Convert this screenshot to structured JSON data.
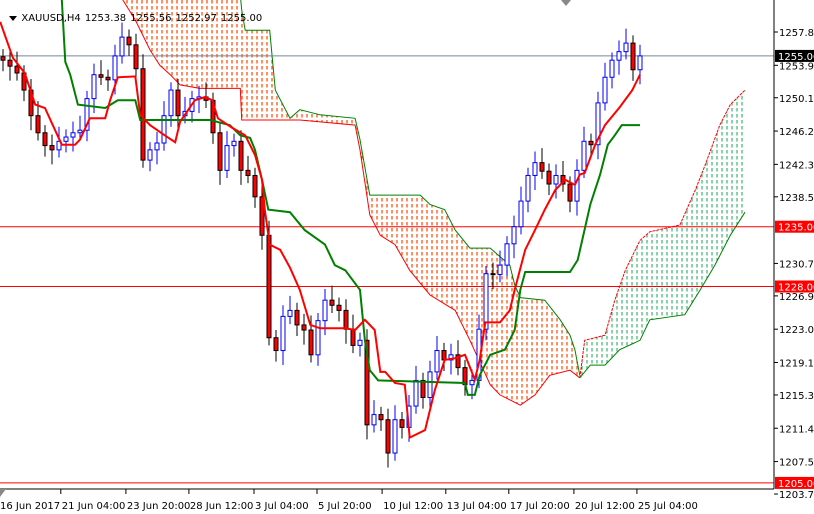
{
  "header": {
    "symbol": "XAUUSD,H4",
    "open": "1253.38",
    "high": "1255.56",
    "low": "1252.97",
    "close": "1255.00"
  },
  "colors": {
    "bull": "#0000ff",
    "bear": "#ff0000",
    "tenkan": "#ff0000",
    "kijun": "#008000",
    "cloud_bear": "#ff4500",
    "cloud_bull": "#3cb371",
    "level": "#ff0000",
    "price_line": "#778899"
  },
  "chart_data": {
    "type": "candlestick",
    "title": "XAUUSD,H4",
    "ylim": [
      1203.7,
      1257.8
    ],
    "y_ticks": [
      "1257.80",
      "1253.90",
      "1250.10",
      "1246.20",
      "1242.30",
      "1238.50",
      "1230.70",
      "1226.90",
      "1223.00",
      "1219.10",
      "1215.30",
      "1211.40",
      "1207.50",
      "1203.70"
    ],
    "x_ticks": [
      {
        "bar": 0,
        "label": "16 Jun 2017"
      },
      {
        "bar": 8.4,
        "label": "21 Jun 04:00"
      },
      {
        "bar": 17.7,
        "label": "23 Jun 20:00"
      },
      {
        "bar": 26.7,
        "label": "28 Jun 12:00"
      },
      {
        "bar": 36,
        "label": "3 Jul 04:00"
      },
      {
        "bar": 45,
        "label": "5 Jul 20:00"
      },
      {
        "bar": 54.3,
        "label": "10 Jul 12:00"
      },
      {
        "bar": 63.4,
        "label": "13 Jul 04:00"
      },
      {
        "bar": 72.4,
        "label": "17 Jul 20:00"
      },
      {
        "bar": 81.7,
        "label": "20 Jul 12:00"
      },
      {
        "bar": 90.7,
        "label": "25 Jul 04:00"
      }
    ],
    "closes": [
      1254.5,
      1253.8,
      1253,
      1251,
      1248,
      1246,
      1244.5,
      1244,
      1245,
      1245.5,
      1246,
      1246.3,
      1250,
      1252.8,
      1252.5,
      1252.2,
      1255,
      1257.2,
      1256.3,
      1253.5,
      1242.8,
      1244,
      1244.8,
      1248,
      1251,
      1248,
      1248.5,
      1250,
      1250.2,
      1249.8,
      1246,
      1241.6,
      1244.5,
      1245,
      1241.6,
      1241,
      1238.5,
      1234,
      1222,
      1220.5,
      1224.5,
      1225.2,
      1223.5,
      1222.9,
      1220,
      1224,
      1226.4,
      1225.8,
      1225.2,
      1223,
      1221.1,
      1221.7,
      1211.8,
      1213,
      1212.4,
      1208.5,
      1212.4,
      1211.5,
      1214,
      1217,
      1215,
      1218,
      1220.5,
      1219.4,
      1220,
      1218.5,
      1216.5,
      1217,
      1223,
      1229.5,
      1229.4,
      1230.5,
      1233,
      1235,
      1238,
      1241,
      1242.5,
      1241.5,
      1240,
      1241,
      1240,
      1238,
      1241.6,
      1245,
      1244.6,
      1249.5,
      1252.5,
      1254.5,
      1255.5,
      1256.5,
      1253.38,
      1255.0
    ],
    "tenkan": [
      [
        -0.4,
        1259
      ],
      [
        1.4,
        1254.8
      ],
      [
        3.1,
        1253
      ],
      [
        4.6,
        1249.3
      ],
      [
        6,
        1248.9
      ],
      [
        7,
        1247.1
      ],
      [
        8.4,
        1244.6
      ],
      [
        10.3,
        1244.6
      ],
      [
        11,
        1245.2
      ],
      [
        12.4,
        1247.7
      ],
      [
        14.6,
        1247.7
      ],
      [
        15.3,
        1249.8
      ],
      [
        16.4,
        1252.5
      ],
      [
        18.9,
        1252.6
      ],
      [
        19.6,
        1248.1
      ],
      [
        21,
        1246.9
      ],
      [
        23.1,
        1245.7
      ],
      [
        24.6,
        1244.9
      ],
      [
        25.3,
        1247.3
      ],
      [
        27.4,
        1249.8
      ],
      [
        28.9,
        1250.2
      ],
      [
        29.9,
        1249.8
      ],
      [
        30.7,
        1247.7
      ],
      [
        32.7,
        1246.6
      ],
      [
        34.6,
        1245.7
      ],
      [
        36,
        1243.4
      ],
      [
        37,
        1240.5
      ],
      [
        37.4,
        1237
      ],
      [
        38.1,
        1232.9
      ],
      [
        39.6,
        1232.3
      ],
      [
        41,
        1230.2
      ],
      [
        42.4,
        1227.6
      ],
      [
        43.9,
        1223.5
      ],
      [
        45.3,
        1223.1
      ],
      [
        48.9,
        1223.1
      ],
      [
        50.3,
        1222.9
      ],
      [
        51.7,
        1224.1
      ],
      [
        53.1,
        1222.9
      ],
      [
        53.9,
        1218
      ],
      [
        54.6,
        1218
      ],
      [
        56,
        1216.7
      ],
      [
        57.4,
        1216.5
      ],
      [
        58.1,
        1210.3
      ],
      [
        60.3,
        1211.2
      ],
      [
        61.7,
        1215.9
      ],
      [
        63.1,
        1219.4
      ],
      [
        64.6,
        1219.6
      ],
      [
        66,
        1220
      ],
      [
        67.4,
        1217.1
      ],
      [
        68.1,
        1219.4
      ],
      [
        68.9,
        1223.8
      ],
      [
        71,
        1223.8
      ],
      [
        72.4,
        1225.2
      ],
      [
        73.1,
        1227.6
      ],
      [
        74.6,
        1232.3
      ],
      [
        76,
        1234.6
      ],
      [
        77.4,
        1237
      ],
      [
        78.9,
        1239.3
      ],
      [
        80.3,
        1240.5
      ],
      [
        81.7,
        1239.9
      ],
      [
        82.4,
        1241.1
      ],
      [
        83.1,
        1241.3
      ],
      [
        84.6,
        1244.6
      ],
      [
        86,
        1246.9
      ],
      [
        88.1,
        1249
      ],
      [
        89.9,
        1251
      ],
      [
        91,
        1252.8
      ]
    ],
    "kijun": [
      [
        8.4,
        1261.6
      ],
      [
        8.9,
        1254.3
      ],
      [
        9.6,
        1252.8
      ],
      [
        10.7,
        1249.3
      ],
      [
        14.6,
        1248.9
      ],
      [
        16.4,
        1249.8
      ],
      [
        18.9,
        1249.8
      ],
      [
        19.6,
        1247.5
      ],
      [
        29.6,
        1247.5
      ],
      [
        32.4,
        1246.9
      ],
      [
        33.9,
        1245.7
      ],
      [
        35.3,
        1245.4
      ],
      [
        36,
        1244
      ],
      [
        37,
        1240.5
      ],
      [
        37.9,
        1237
      ],
      [
        41,
        1236.7
      ],
      [
        43.1,
        1234.6
      ],
      [
        46,
        1232.9
      ],
      [
        47.4,
        1230.5
      ],
      [
        48.9,
        1229.9
      ],
      [
        51,
        1227.6
      ],
      [
        51.7,
        1221.7
      ],
      [
        52.4,
        1218.2
      ],
      [
        53.6,
        1217
      ],
      [
        66,
        1216.7
      ],
      [
        66.4,
        1215.3
      ],
      [
        67.4,
        1215.3
      ],
      [
        68.1,
        1217.6
      ],
      [
        69.6,
        1220
      ],
      [
        71.7,
        1220.6
      ],
      [
        73.1,
        1222.9
      ],
      [
        73.9,
        1227.6
      ],
      [
        74.6,
        1229.7
      ],
      [
        81,
        1229.7
      ],
      [
        82.1,
        1231.1
      ],
      [
        83.9,
        1237.6
      ],
      [
        85.3,
        1241.1
      ],
      [
        86.4,
        1244.6
      ],
      [
        87.4,
        1245.7
      ],
      [
        88.4,
        1246.9
      ],
      [
        91,
        1246.9
      ]
    ],
    "cloud_bear_upper": [
      [
        18.1,
        1262.1
      ],
      [
        33.9,
        1262.1
      ],
      [
        34.1,
        1260.4
      ],
      [
        34.6,
        1258
      ],
      [
        38.1,
        1258
      ],
      [
        38.9,
        1251
      ],
      [
        41,
        1247.7
      ],
      [
        42.4,
        1248.7
      ],
      [
        45.3,
        1248.1
      ],
      [
        50.3,
        1247.7
      ],
      [
        51,
        1245.2
      ],
      [
        52.4,
        1238.7
      ],
      [
        59.6,
        1238.7
      ],
      [
        61,
        1237.6
      ],
      [
        63.1,
        1237
      ],
      [
        64.6,
        1234.6
      ],
      [
        66.7,
        1232.5
      ],
      [
        69.6,
        1232.5
      ],
      [
        72.4,
        1230.5
      ],
      [
        73.1,
        1228.2
      ],
      [
        73.9,
        1226.7
      ],
      [
        77.4,
        1226.4
      ],
      [
        79.6,
        1224.1
      ],
      [
        81,
        1222.3
      ],
      [
        81.7,
        1220.6
      ],
      [
        82.4,
        1217.6
      ]
    ],
    "cloud_bear_lower": [
      [
        16.7,
        1262.1
      ],
      [
        18.9,
        1259.2
      ],
      [
        21,
        1255.7
      ],
      [
        22.4,
        1253.9
      ],
      [
        23.9,
        1252.8
      ],
      [
        25.3,
        1251.6
      ],
      [
        28.1,
        1251.2
      ],
      [
        33.9,
        1251.2
      ],
      [
        34.1,
        1247.5
      ],
      [
        42.4,
        1247.5
      ],
      [
        50.3,
        1246.9
      ],
      [
        51,
        1244
      ],
      [
        52.4,
        1236.4
      ],
      [
        53.9,
        1234
      ],
      [
        56,
        1232.9
      ],
      [
        58.1,
        1229.9
      ],
      [
        61,
        1227
      ],
      [
        64.6,
        1225.2
      ],
      [
        66.7,
        1221.7
      ],
      [
        69.6,
        1216.5
      ],
      [
        71,
        1215.3
      ],
      [
        73.9,
        1214.1
      ],
      [
        76,
        1215.3
      ],
      [
        78.1,
        1217.6
      ],
      [
        81,
        1218.2
      ],
      [
        82.4,
        1217.3
      ]
    ],
    "cloud_bull_upper": [
      [
        82.4,
        1217.3
      ],
      [
        83.1,
        1221.7
      ],
      [
        86,
        1222.3
      ],
      [
        87.4,
        1226.4
      ],
      [
        88.9,
        1229.9
      ],
      [
        91,
        1233.4
      ],
      [
        92.4,
        1234.4
      ],
      [
        96.7,
        1235.2
      ],
      [
        98.9,
        1239.3
      ],
      [
        100.3,
        1242.2
      ],
      [
        102.4,
        1246.9
      ],
      [
        103.9,
        1249.3
      ],
      [
        106,
        1251
      ]
    ],
    "cloud_bull_lower": [
      [
        82.4,
        1217.3
      ],
      [
        83.9,
        1218.8
      ],
      [
        86,
        1218.8
      ],
      [
        88.1,
        1220.6
      ],
      [
        91,
        1221.7
      ],
      [
        92.4,
        1224.1
      ],
      [
        97.4,
        1224.7
      ],
      [
        99.6,
        1227.6
      ],
      [
        101.7,
        1230.5
      ],
      [
        103.9,
        1234
      ],
      [
        106,
        1236.7
      ]
    ],
    "levels": [
      {
        "price": 1255.0,
        "label": "1255.00",
        "kind": "current"
      },
      {
        "price": 1235.0,
        "label": "1235.00",
        "kind": "level"
      },
      {
        "price": 1228.0,
        "label": "1228.00",
        "kind": "level"
      },
      {
        "price": 1205.0,
        "label": "1205.00",
        "kind": "level"
      }
    ]
  }
}
